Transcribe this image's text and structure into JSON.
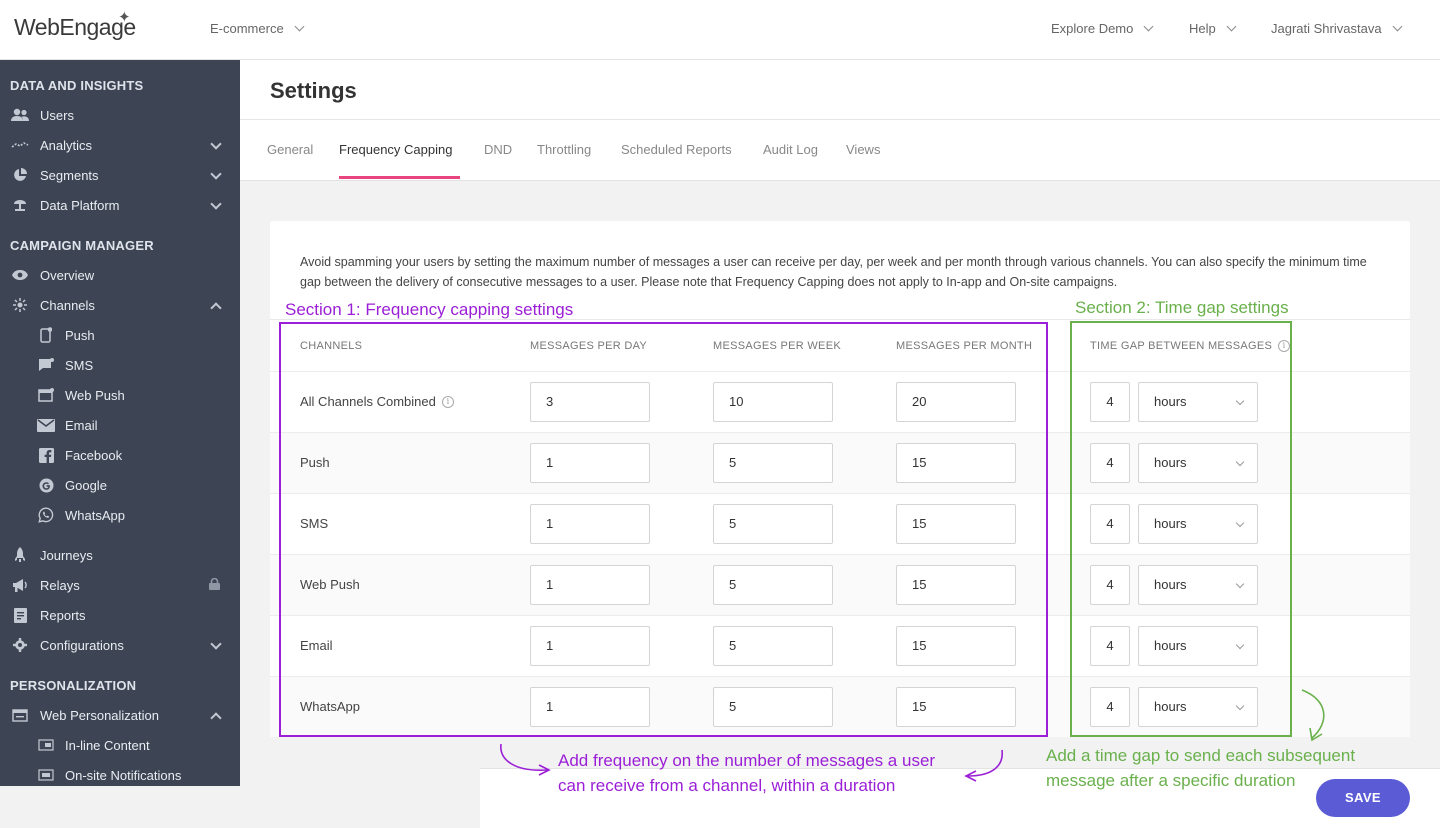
{
  "brand": {
    "logo": "WebEngage",
    "accent": "#e8457f",
    "primary": "#5b5bd6",
    "sidebar_bg": "#3d4554"
  },
  "topbar": {
    "project": "E-commerce",
    "explore": "Explore Demo",
    "help": "Help",
    "user": "Jagrati Shrivastava"
  },
  "sidebar": {
    "sections": [
      "DATA AND INSIGHTS",
      "CAMPAIGN MANAGER",
      "PERSONALIZATION"
    ],
    "items": [
      {
        "label": "Users",
        "icon": "users-icon"
      },
      {
        "label": "Analytics",
        "icon": "analytics-icon"
      },
      {
        "label": "Segments",
        "icon": "segments-icon"
      },
      {
        "label": "Data Platform",
        "icon": "data-platform-icon"
      },
      {
        "label": "Overview",
        "icon": "eye-icon"
      },
      {
        "label": "Channels",
        "icon": "channels-icon"
      },
      {
        "label": "Push",
        "icon": "push-icon"
      },
      {
        "label": "SMS",
        "icon": "sms-icon"
      },
      {
        "label": "Web Push",
        "icon": "web-push-icon"
      },
      {
        "label": "Email",
        "icon": "email-icon"
      },
      {
        "label": "Facebook",
        "icon": "facebook-icon"
      },
      {
        "label": "Google",
        "icon": "google-icon"
      },
      {
        "label": "WhatsApp",
        "icon": "whatsapp-icon"
      },
      {
        "label": "Journeys",
        "icon": "journeys-icon"
      },
      {
        "label": "Relays",
        "icon": "relays-icon"
      },
      {
        "label": "Reports",
        "icon": "reports-icon"
      },
      {
        "label": "Configurations",
        "icon": "configurations-icon"
      },
      {
        "label": "Web Personalization",
        "icon": "web-personalization-icon"
      },
      {
        "label": "In-line Content",
        "icon": "inline-content-icon"
      },
      {
        "label": "On-site Notifications",
        "icon": "onsite-notifications-icon"
      }
    ]
  },
  "page": {
    "title": "Settings"
  },
  "tabs": [
    "General",
    "Frequency Capping",
    "DND",
    "Throttling",
    "Scheduled Reports",
    "Audit Log",
    "Views"
  ],
  "active_tab": "Frequency Capping",
  "description": "Avoid spamming your users by setting the maximum number of messages a user can receive per day, per week and per month through various channels. You can also specify the minimum time gap between the delivery of consecutive messages to a user. Please note that Frequency Capping does not apply to In-app and On-site campaigns.",
  "table": {
    "headers": [
      "CHANNELS",
      "MESSAGES PER DAY",
      "MESSAGES PER WEEK",
      "MESSAGES PER MONTH",
      "TIME GAP BETWEEN MESSAGES"
    ],
    "rows": [
      {
        "channel": "All Channels Combined",
        "day": "3",
        "week": "10",
        "month": "20",
        "gap": "4",
        "unit": "hours"
      },
      {
        "channel": "Push",
        "day": "1",
        "week": "5",
        "month": "15",
        "gap": "4",
        "unit": "hours"
      },
      {
        "channel": "SMS",
        "day": "1",
        "week": "5",
        "month": "15",
        "gap": "4",
        "unit": "hours"
      },
      {
        "channel": "Web Push",
        "day": "1",
        "week": "5",
        "month": "15",
        "gap": "4",
        "unit": "hours"
      },
      {
        "channel": "Email",
        "day": "1",
        "week": "5",
        "month": "15",
        "gap": "4",
        "unit": "hours"
      },
      {
        "channel": "WhatsApp",
        "day": "1",
        "week": "5",
        "month": "15",
        "gap": "4",
        "unit": "hours"
      }
    ]
  },
  "annotations": {
    "section1": "Section 1: Frequency capping settings",
    "section2": "Section 2: Time gap settings",
    "note1_line1": "Add frequency on the number of messages a user",
    "note1_line2": "can receive from a channel, within a duration",
    "note2_line1": "Add a time gap to send each subsequent",
    "note2_line2": "message after a specific duration"
  },
  "save_label": "SAVE"
}
